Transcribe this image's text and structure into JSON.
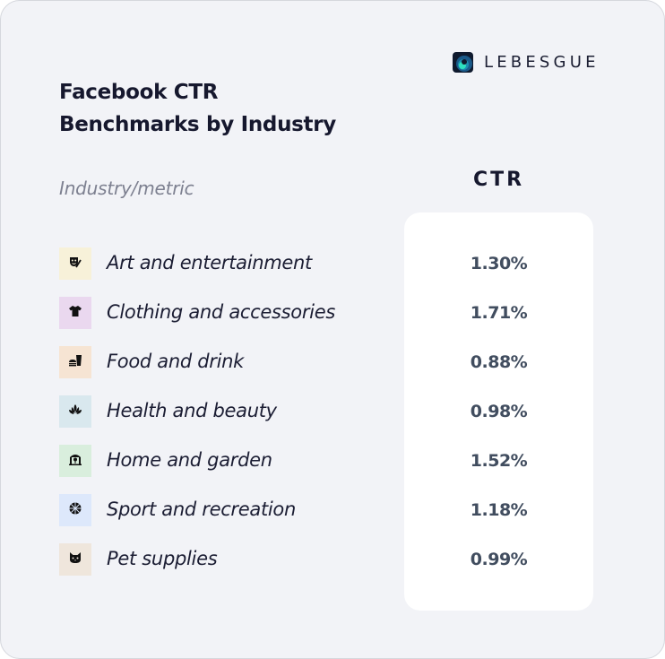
{
  "brand": {
    "logo_icon": "wave-logo-icon",
    "name": "LEBESGUE"
  },
  "title_line1": "Facebook CTR",
  "title_line2": "Benchmarks by Industry",
  "column_label": "Industry/metric",
  "metric_header": "CTR",
  "colors": {
    "background": "#f2f3f7",
    "panel": "#ffffff",
    "title": "#16182e",
    "value_text": "#414d5f",
    "muted_text": "#7d8090"
  },
  "rows": [
    {
      "label": "Art and entertainment",
      "value": "1.30%",
      "icon": "theater-mask-icon",
      "tile_color": "#f7f1d9"
    },
    {
      "label": "Clothing and accessories",
      "value": "1.71%",
      "icon": "tshirt-icon",
      "tile_color": "#ead8ef"
    },
    {
      "label": "Food and drink",
      "value": "0.88%",
      "icon": "burger-drink-icon",
      "tile_color": "#f6e4d3"
    },
    {
      "label": "Health and beauty",
      "value": "0.98%",
      "icon": "lotus-icon",
      "tile_color": "#d9e8ee"
    },
    {
      "label": "Home and garden",
      "value": "1.52%",
      "icon": "greenhouse-icon",
      "tile_color": "#d9eedd"
    },
    {
      "label": "Sport and recreation",
      "value": "1.18%",
      "icon": "basketball-icon",
      "tile_color": "#dde8fb"
    },
    {
      "label": "Pet supplies",
      "value": "0.99%",
      "icon": "cat-icon",
      "tile_color": "#efe6dc"
    }
  ]
}
